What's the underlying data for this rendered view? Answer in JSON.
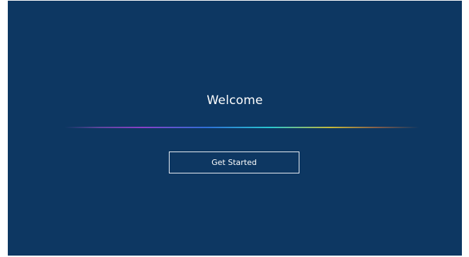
{
  "welcome": {
    "title": "Welcome",
    "button_label": "Get Started"
  },
  "colors": {
    "background": "#0d3762",
    "text": "#ffffff",
    "button_border": "#e8edf3"
  }
}
